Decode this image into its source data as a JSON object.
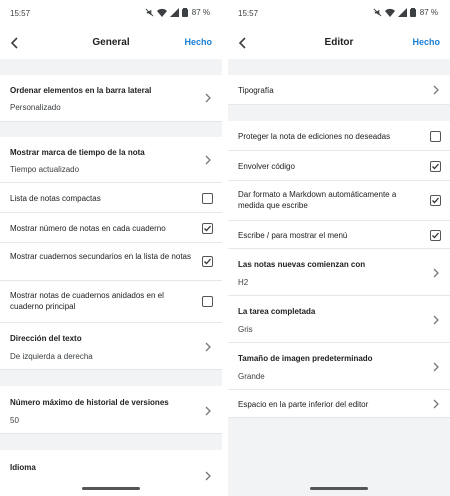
{
  "left": {
    "status": {
      "time": "15:57",
      "battery": "87 %"
    },
    "appbar": {
      "title": "General",
      "done": "Hecho"
    },
    "items": [
      {
        "title": "Ordenar elementos en la barra lateral",
        "subtitle": "Personalizado"
      },
      {
        "title": "Mostrar marca de tiempo de la nota",
        "subtitle": "Tiempo actualizado"
      },
      {
        "title": "Lista de notas compactas",
        "checked": false
      },
      {
        "title": "Mostrar número de notas en cada cuaderno",
        "checked": true
      },
      {
        "title": "Mostrar cuadernos secundarios en la lista de notas",
        "checked": true
      },
      {
        "title": "Mostrar notas de cuadernos anidados en el cuaderno principal",
        "checked": false
      },
      {
        "title": "Dirección del texto",
        "subtitle": "De izquierda a derecha"
      },
      {
        "title": "Número máximo de historial de versiones",
        "subtitle": "50"
      },
      {
        "title": "Idioma"
      }
    ]
  },
  "right": {
    "status": {
      "time": "15:57",
      "battery": "87 %"
    },
    "appbar": {
      "title": "Editor",
      "done": "Hecho"
    },
    "items": [
      {
        "title": "Tipografía"
      },
      {
        "title": "Proteger la nota de ediciones no deseadas",
        "checked": false
      },
      {
        "title": "Envolver código",
        "checked": true
      },
      {
        "title": "Dar formato a Markdown automáticamente a medida que escribe",
        "checked": true
      },
      {
        "title": "Escribe / para mostrar el menú",
        "checked": true
      },
      {
        "title": "Las notas nuevas comienzan con",
        "subtitle": "H2"
      },
      {
        "title": "La tarea completada",
        "subtitle": "Gris"
      },
      {
        "title": "Tamaño de imagen predeterminado",
        "subtitle": "Grande"
      },
      {
        "title": "Espacio en la parte inferior del editor"
      }
    ]
  }
}
